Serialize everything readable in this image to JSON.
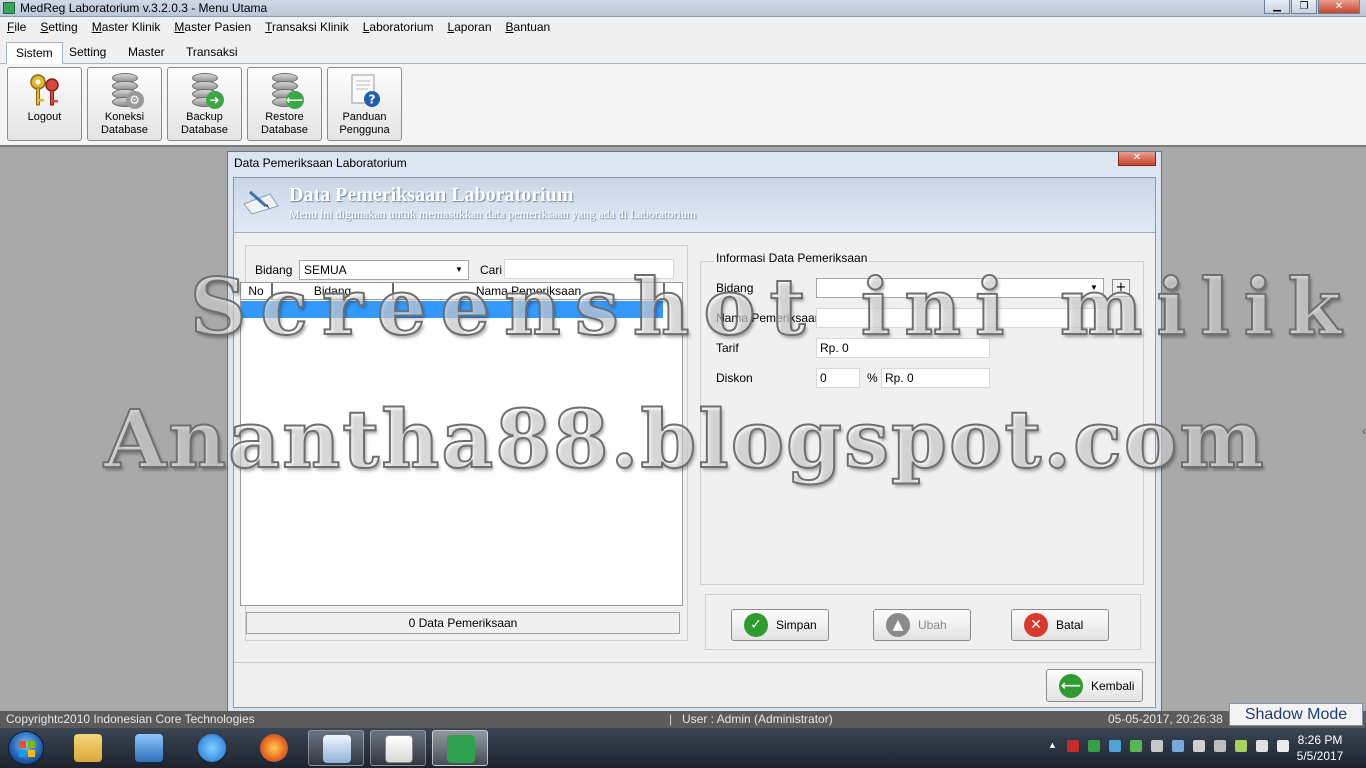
{
  "window": {
    "title": "MedReg Laboratorium v.3.2.0.3 - Menu Utama",
    "buttons": [
      "▁",
      "❐",
      "✕"
    ]
  },
  "menubar": {
    "items": [
      {
        "u": "F",
        "rest": "ile"
      },
      {
        "u": "S",
        "rest": "etting"
      },
      {
        "u": "M",
        "rest": "aster Klinik"
      },
      {
        "u": "M",
        "rest": "aster Pasien"
      },
      {
        "u": "T",
        "rest": "ransaksi Klinik"
      },
      {
        "u": "L",
        "rest": "aboratorium"
      },
      {
        "u": "L",
        "rest": "aporan"
      },
      {
        "u": "B",
        "rest": "antuan"
      }
    ]
  },
  "ribbon": {
    "tabs": [
      "Sistem",
      "Setting",
      "Master",
      "Transaksi"
    ],
    "active_tab": "Sistem",
    "buttons": [
      {
        "line1": "Logout",
        "line2": "",
        "icon": "keys-icon"
      },
      {
        "line1": "Koneksi",
        "line2": "Database",
        "icon": "database-gear-icon"
      },
      {
        "line1": "Backup",
        "line2": "Database",
        "icon": "database-backup-icon"
      },
      {
        "line1": "Restore",
        "line2": "Database",
        "icon": "database-restore-icon"
      },
      {
        "line1": "Panduan",
        "line2": "Pengguna",
        "icon": "help-document-icon"
      }
    ]
  },
  "dialog": {
    "title": "Data Pemeriksaan Laboratorium",
    "close": "✕",
    "header_title": "Data Pemeriksaan Laboratorium",
    "header_subtitle": "Menu ini digunakan untuk memasukkan data pemeriksaan yang ada di Laboratorium",
    "left": {
      "bidang_label": "Bidang",
      "bidang_value": "SEMUA",
      "cari_label": "Cari",
      "cari_value": "",
      "columns": [
        "No",
        "Bidang",
        "Nama Pemeriksaan"
      ],
      "rows": [],
      "count_text": "0 Data Pemeriksaan"
    },
    "right": {
      "group_title": "Informasi Data Pemeriksaan",
      "bidang_label": "Bidang",
      "bidang_value": "",
      "nama_label": "Nama Pemeriksaan",
      "nama_value": "",
      "tarif_label": "Tarif",
      "tarif_value": "Rp. 0",
      "diskon_label": "Diskon",
      "diskon_value": "0",
      "percent": "%",
      "diskon_rp": "Rp. 0",
      "plus": "+"
    },
    "actions": {
      "simpan": "Simpan",
      "ubah": "Ubah",
      "batal": "Batal",
      "kembali": "Kembali"
    }
  },
  "statusbar": {
    "copyright": "Copyrightc2010 Indonesian Core Technologies",
    "separator": "|",
    "user": "User : Admin (Administrator)",
    "datetime": "05-05-2017, 20:26:38"
  },
  "shadow_mode": "Shadow Mode",
  "watermark": {
    "line1": "Screenshot ini milik",
    "line2": "Anantha88.blogspot.com"
  },
  "taskbar": {
    "clock_time": "8:26 PM",
    "clock_date": "5/5/2017",
    "apps": [
      "explorer-icon",
      "media-player-icon",
      "internet-explorer-icon",
      "firefox-icon",
      "notepad-icon",
      "calendar-icon",
      "medreg-icon"
    ]
  },
  "colors": {
    "selection": "#3399ff",
    "simpan_icon": "#2e9b2e",
    "ubah_icon": "#8a8a8a",
    "batal_icon": "#d63a2a",
    "kembali_icon": "#2e9b2e"
  }
}
